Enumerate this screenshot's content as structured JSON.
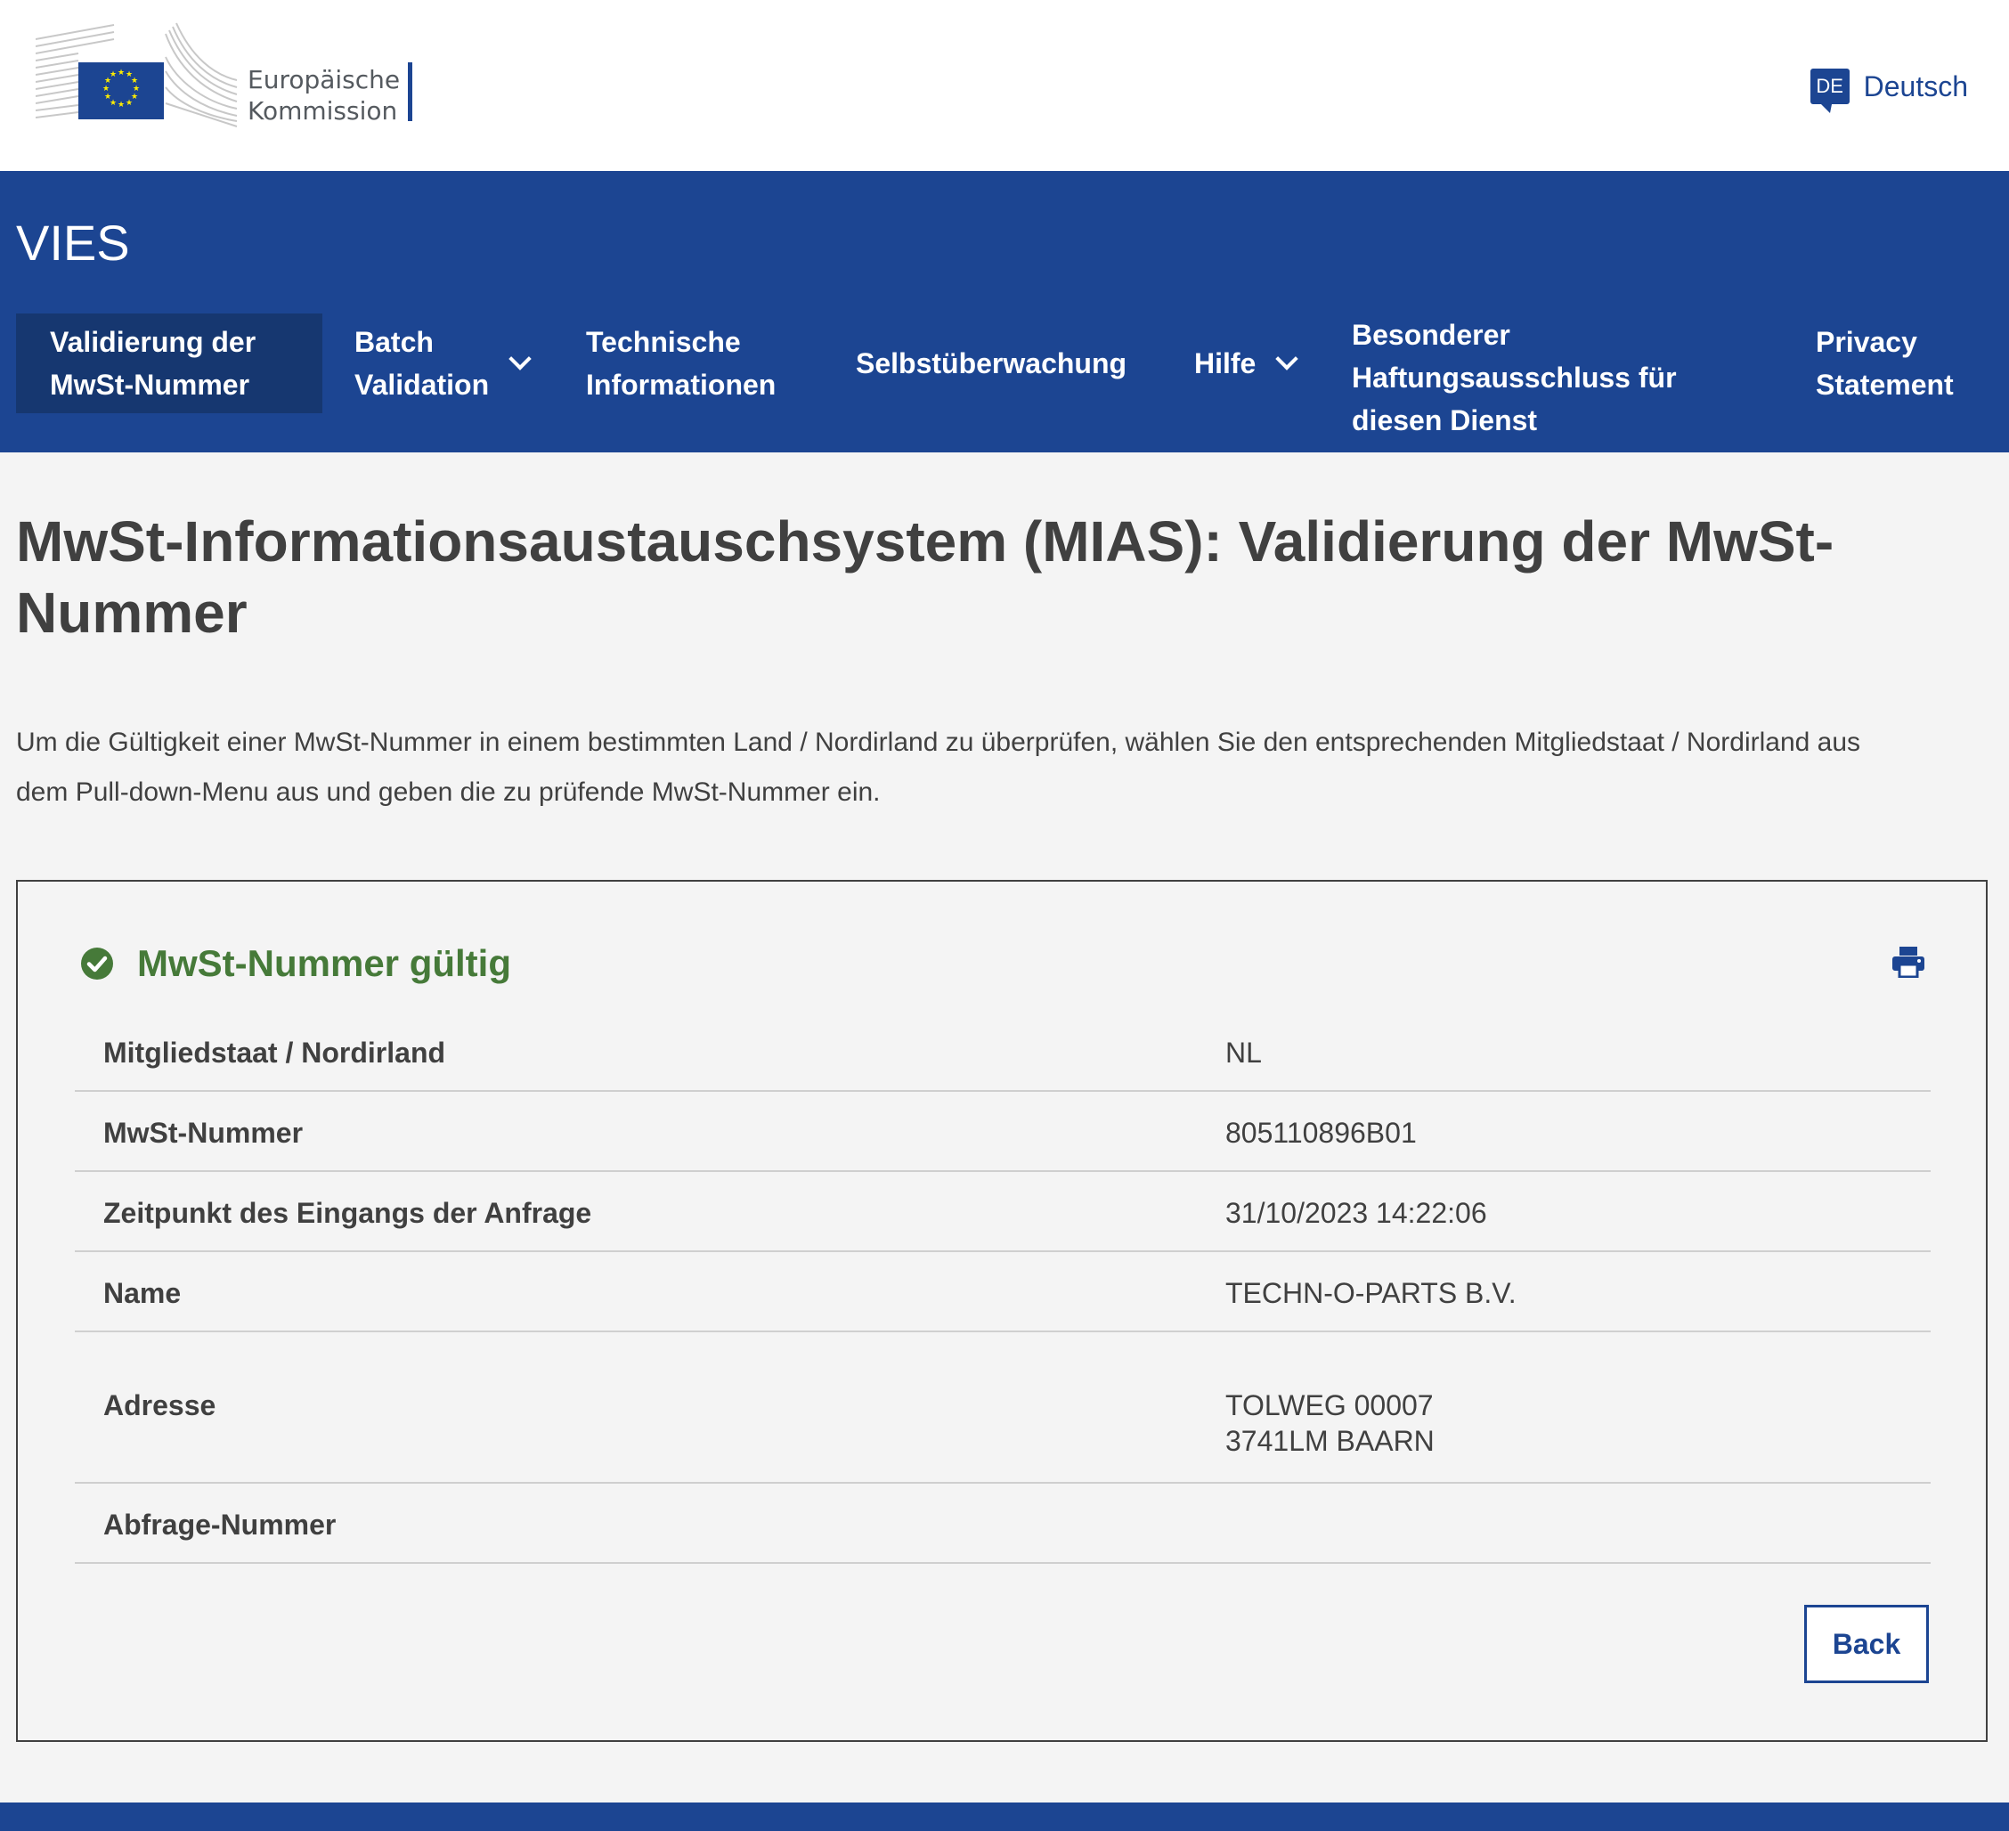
{
  "header": {
    "logo_line1": "Europäische",
    "logo_line2": "Kommission",
    "language_code": "DE",
    "language_label": "Deutsch"
  },
  "site": {
    "name": "VIES"
  },
  "nav": {
    "items": [
      {
        "line1": "Validierung der",
        "line2": "MwSt-Nummer",
        "active": true
      },
      {
        "line1": "Batch",
        "line2": "Validation",
        "dropdown": true
      },
      {
        "line1": "Technische",
        "line2": "Informationen"
      },
      {
        "line1": "Selbstüberwachung"
      },
      {
        "line1": "Hilfe",
        "dropdown": true
      },
      {
        "line1": "Besonderer",
        "line2": "Haftungsausschluss für",
        "line3": "diesen Dienst"
      },
      {
        "line1": "Privacy",
        "line2": "Statement"
      }
    ]
  },
  "main": {
    "title_line1": "MwSt-Informationsaustauschsystem (MIAS): Validierung der MwSt-",
    "title_line2": "Nummer",
    "intro_line1": "Um die Gültigkeit einer MwSt-Nummer in einem bestimmten Land / Nordirland zu überprüfen, wählen Sie den entsprechenden Mitgliedstaat / Nordirland aus",
    "intro_line2": "dem Pull-down-Menu aus und geben die zu prüfende MwSt-Nummer ein."
  },
  "result": {
    "status": "MwSt-Nummer gültig",
    "rows": [
      {
        "label": "Mitgliedstaat / Nordirland",
        "value": "NL"
      },
      {
        "label": "MwSt-Nummer",
        "value": "805110896B01"
      },
      {
        "label": "Zeitpunkt des Eingangs der Anfrage",
        "value": "31/10/2023 14:22:06"
      },
      {
        "label": "Name",
        "value": "TECHN-O-PARTS B.V."
      },
      {
        "label": "Adresse",
        "value": "TOLWEG 00007",
        "value2": "3741LM BAARN"
      },
      {
        "label": "Abfrage-Nummer",
        "value": ""
      }
    ],
    "back_label": "Back"
  },
  "colors": {
    "brand_blue": "#1c4592",
    "active_nav": "#163770",
    "valid_green": "#467a39",
    "eu_yellow": "#ffed00"
  },
  "icons": {
    "status": "check-circle-icon",
    "print": "printer-icon",
    "language": "speech-bubble-icon",
    "dropdown": "chevron-down-icon"
  }
}
